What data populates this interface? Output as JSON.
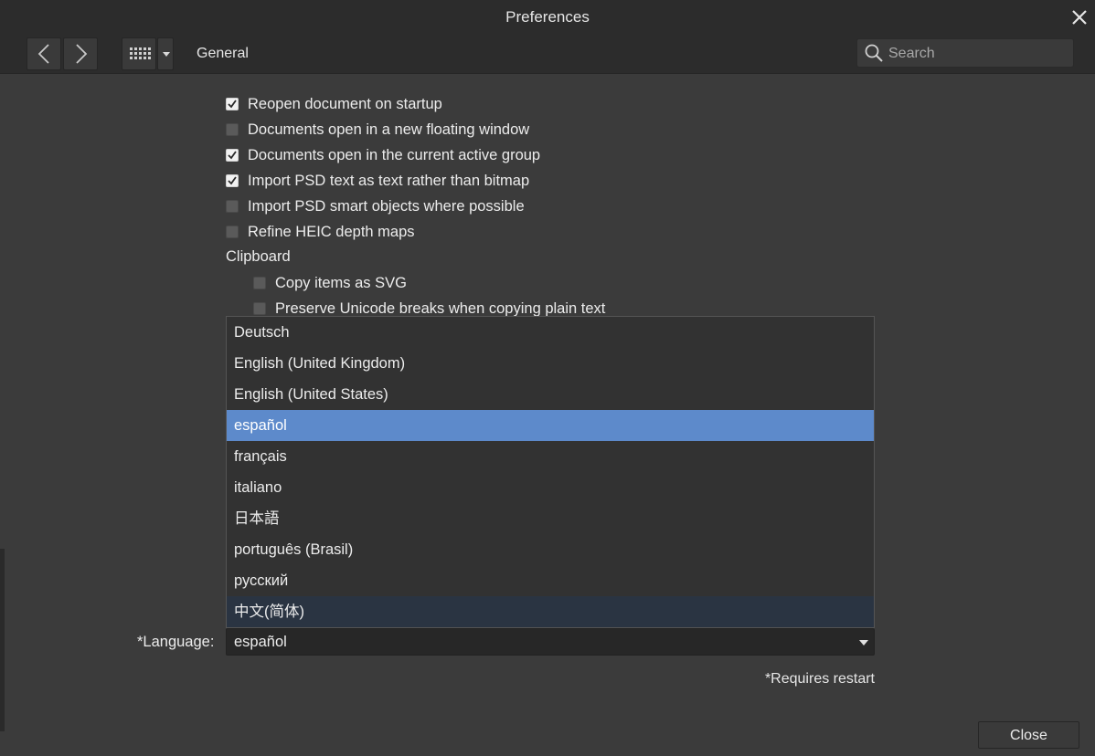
{
  "window": {
    "title": "Preferences"
  },
  "toolbar": {
    "section_label": "General",
    "search_placeholder": "Search"
  },
  "options": [
    {
      "label": "Reopen document on startup",
      "checked": true
    },
    {
      "label": "Documents open in a new floating window",
      "checked": false
    },
    {
      "label": "Documents open in the current active group",
      "checked": true
    },
    {
      "label": "Import PSD text as text rather than bitmap",
      "checked": true
    },
    {
      "label": "Import PSD smart objects where possible",
      "checked": false
    },
    {
      "label": "Refine HEIC depth maps",
      "checked": false
    }
  ],
  "clipboard": {
    "heading": "Clipboard",
    "options": [
      {
        "label": "Copy items as SVG",
        "checked": false
      },
      {
        "label": "Preserve Unicode breaks when copying plain text",
        "checked": false
      }
    ]
  },
  "language": {
    "label": "*Language:",
    "selected": "español",
    "options": [
      "Deutsch",
      "English (United Kingdom)",
      "English (United States)",
      "español",
      "français",
      "italiano",
      "日本語",
      "português (Brasil)",
      "русский",
      "中文(简体)"
    ],
    "hovered": "中文(简体)"
  },
  "note": "*Requires restart",
  "close_button": "Close",
  "colors": {
    "selection": "#5d8acb",
    "background": "#3b3b3b",
    "chrome": "#2c2c2c"
  }
}
